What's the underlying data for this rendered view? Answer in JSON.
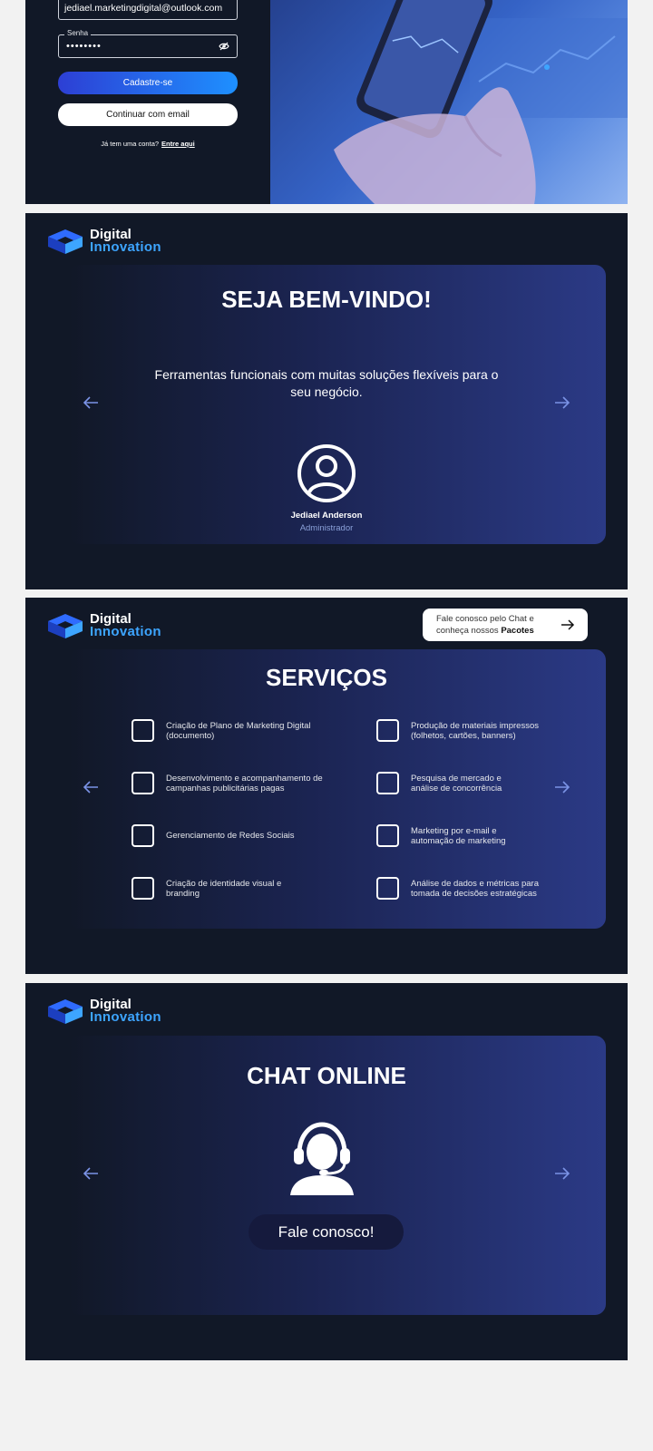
{
  "signup": {
    "email_value": "jediael.marketingdigital@outlook.com",
    "password_label": "Senha",
    "password_value": "••••••••",
    "signup_button": "Cadastre-se",
    "email_button": "Continuar com email",
    "has_account_text": "Já tem uma conta?",
    "login_link": "Entre aqui"
  },
  "brand": {
    "line1": "Digital",
    "line2": "Innovation",
    "accent_color": "#3da5ff"
  },
  "welcome": {
    "title": "SEJA BEM-VINDO!",
    "text": "Ferramentas funcionais com muitas soluções flexíveis para o seu negócio.",
    "user_name": "Jediael Anderson",
    "user_role": "Administrador"
  },
  "services": {
    "cta_line1": "Fale conosco pelo Chat e",
    "cta_line2_prefix": "conheça nossos",
    "cta_line2_bold": "Pacotes",
    "title": "SERVIÇOS",
    "items": [
      "Criação de Plano de Marketing Digital (documento)",
      "Produção de materiais impressos (folhetos, cartões, banners)",
      "Desenvolvimento e acompanhamento de campanhas publicitárias pagas",
      "Pesquisa de mercado e análise de concorrência",
      "Gerenciamento de Redes Sociais",
      "Marketing por e-mail e automação de marketing",
      "Criação de identidade visual e branding",
      "Análise de dados e métricas para tomada de decisões estratégicas"
    ]
  },
  "chat": {
    "title": "CHAT ONLINE",
    "button": "Fale conosco!"
  },
  "icons": [
    "eye-off-icon",
    "logo-cube-icon",
    "arrow-left-icon",
    "arrow-right-icon",
    "user-circle-icon",
    "support-agent-icon"
  ]
}
